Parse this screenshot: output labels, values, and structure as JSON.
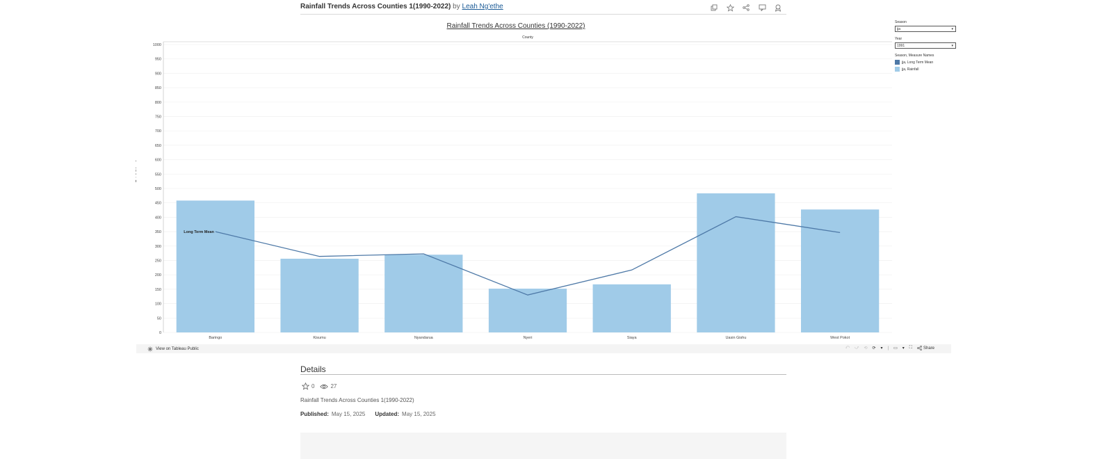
{
  "header": {
    "title": "Rainfall Trends Across Counties 1(1990-2022)",
    "by": "by",
    "author": "Leah Ng'ethe"
  },
  "icons": [
    "copy-icon",
    "star-icon",
    "share-icon",
    "comment-icon",
    "download-icon"
  ],
  "dashboard": {
    "title": "Rainfall Trends Across Counties (1990-2022)",
    "column_header": "County"
  },
  "filters": {
    "season_label": "Season",
    "season_value": "jja",
    "year_label": "Year",
    "year_value": "1991"
  },
  "legend": {
    "title": "Season, Measure Names",
    "items": [
      {
        "label": "jja, Long Term Mean",
        "color": "#4e79a7"
      },
      {
        "label": "jja, Rainfall",
        "color": "#a0cbe8"
      }
    ]
  },
  "chart_data": {
    "type": "bar",
    "categories": [
      "Baringo",
      "Kisumu",
      "Nyandarua",
      "Nyeri",
      "Siaya",
      "Uasin Gishu",
      "West Pokot"
    ],
    "series": [
      {
        "name": "jja, Rainfall",
        "type": "bar",
        "color": "#a0cbe8",
        "values": [
          458,
          256,
          270,
          152,
          167,
          483,
          427
        ]
      },
      {
        "name": "jja, Long Term Mean",
        "type": "line",
        "color": "#4e79a7",
        "values": [
          350,
          264,
          273,
          130,
          217,
          402,
          347
        ]
      }
    ],
    "line_annotation": "Long Term Mean",
    "title": "Rainfall Trends Across Counties (1990-2022)",
    "xlabel": "County",
    "ylabel": "Rainfall (mm)",
    "ylim": [
      0,
      1000
    ],
    "yticks": [
      0,
      50,
      100,
      150,
      200,
      250,
      300,
      350,
      400,
      450,
      500,
      550,
      600,
      650,
      700,
      750,
      800,
      850,
      900,
      950,
      1000
    ],
    "grid": true
  },
  "toolbar": {
    "view_on": "View on Tableau Public",
    "share": "Share"
  },
  "details": {
    "title": "Details",
    "favorites": "0",
    "views": "27",
    "description": "Rainfall Trends Across Counties 1(1990-2022)",
    "published_label": "Published:",
    "published_value": "May 15, 2025",
    "updated_label": "Updated:",
    "updated_value": "May 15, 2025"
  }
}
